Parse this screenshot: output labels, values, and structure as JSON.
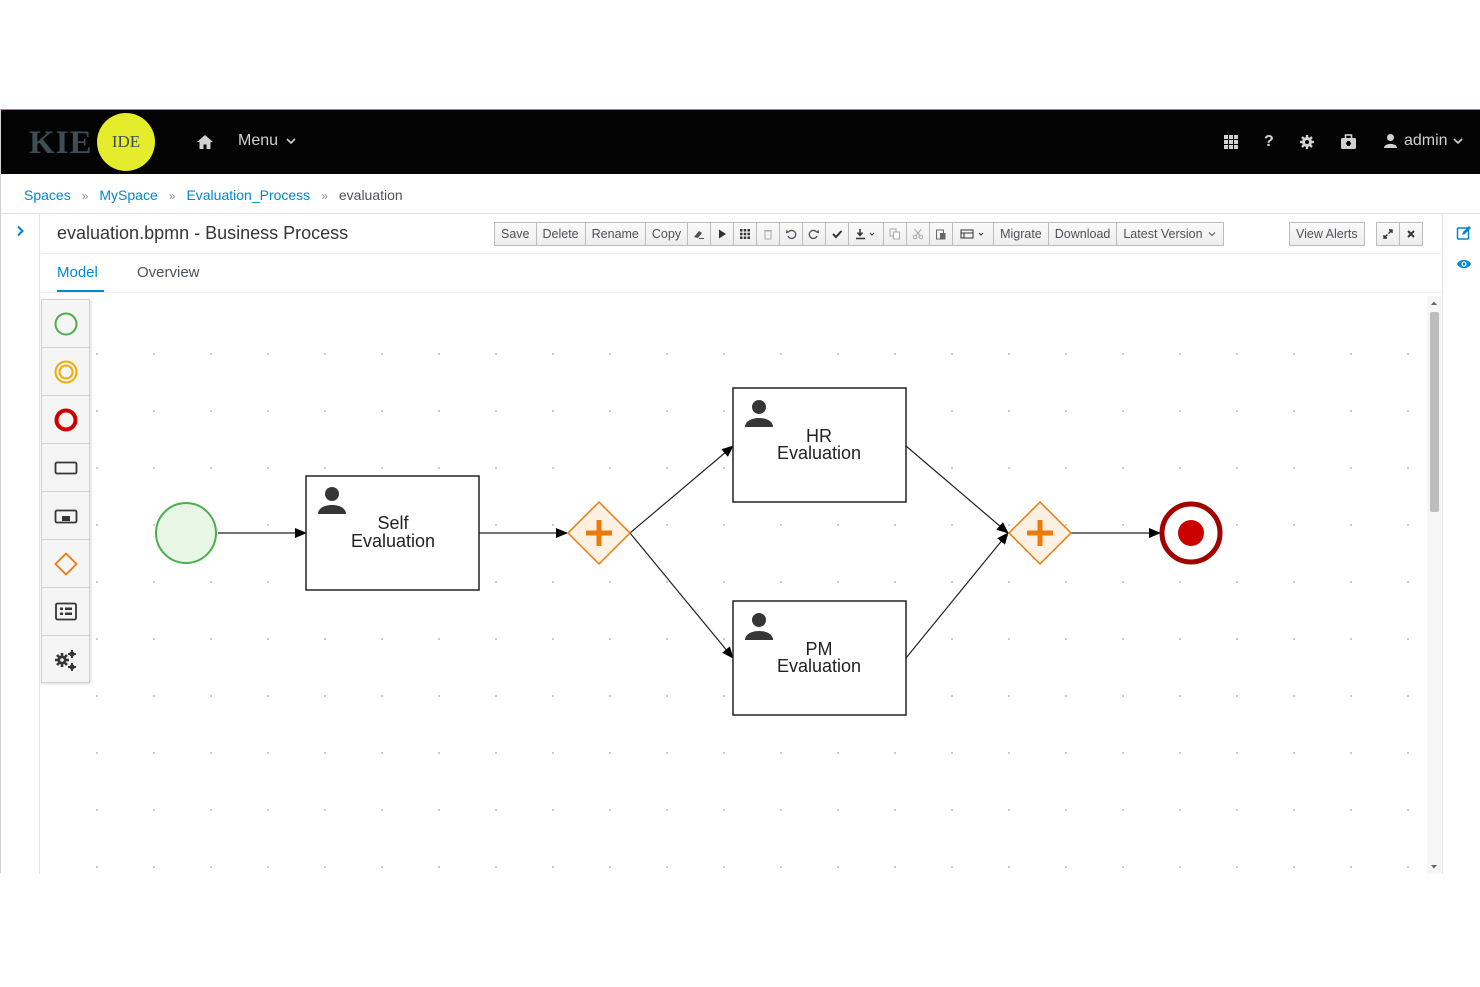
{
  "nav": {
    "logo_text": "KIE",
    "logo_badge": "IDE",
    "menu_label": "Menu",
    "user_label": "admin",
    "home_icon": "home-icon",
    "apps_icon": "grid-icon",
    "help_icon": "question-icon",
    "settings_icon": "gear-icon",
    "tasks_icon": "briefcase-icon",
    "user_icon": "user-icon"
  },
  "breadcrumb": [
    "Spaces",
    "MySpace",
    "Evaluation_Process",
    "evaluation"
  ],
  "editor": {
    "title": "evaluation.bpmn - Business Process",
    "toolbar": {
      "save": "Save",
      "delete": "Delete",
      "rename": "Rename",
      "copy": "Copy",
      "migrate": "Migrate",
      "download": "Download",
      "latest_version": "Latest Version",
      "view_alerts": "View Alerts"
    },
    "tabs": [
      "Model",
      "Overview"
    ],
    "active_tab": "Model"
  },
  "palette": [
    "start-event",
    "intermediate-event",
    "end-event",
    "task",
    "subprocess",
    "gateway",
    "data-object",
    "custom-tasks"
  ],
  "diagram": {
    "tasks": [
      {
        "id": "self",
        "line1": "Self",
        "line2": "Evaluation"
      },
      {
        "id": "hr",
        "line1": "HR",
        "line2": "Evaluation"
      },
      {
        "id": "pm",
        "line1": "PM",
        "line2": "Evaluation"
      }
    ],
    "colors": {
      "start": "#4cae4c",
      "start_fill": "#e8f6e5",
      "gateway": "#ec7a08",
      "gateway_fill": "#fdf1e4",
      "end": "#a30000",
      "end_fill": "#cc0000"
    }
  }
}
